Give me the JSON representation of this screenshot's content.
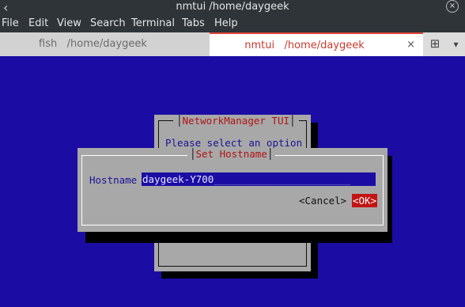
{
  "window": {
    "title": "nmtui  /home/daygeek",
    "menu_icon": "‹",
    "close_icon": "×"
  },
  "menubar": {
    "items": [
      "File",
      "Edit",
      "View",
      "Search",
      "Terminal",
      "Tabs",
      "Help"
    ]
  },
  "tabs": [
    {
      "label": "fish   /home/daygeek",
      "active": false
    },
    {
      "label": "nmtui   /home/daygeek",
      "active": true,
      "close": "×"
    }
  ],
  "tab_actions": {
    "new_tab_icon": "⊞",
    "menu_icon": "▾"
  },
  "tui": {
    "main_dialog": {
      "title": "NetworkManager TUI",
      "prompt": "Please select an option"
    },
    "hostname_dialog": {
      "title": "Set Hostname",
      "field_label": "Hostname",
      "field_value": "daygeek-Y700",
      "field_fill": "_______________________",
      "cancel_button": "<Cancel>",
      "ok_button": "<OK>"
    }
  },
  "colors": {
    "terminal_bg": "#1b0da4",
    "dialog_bg": "#a8a8a8",
    "title_text": "#b01414",
    "ok_button_bg": "#c31414",
    "active_tab_text": "#c83a2d"
  }
}
